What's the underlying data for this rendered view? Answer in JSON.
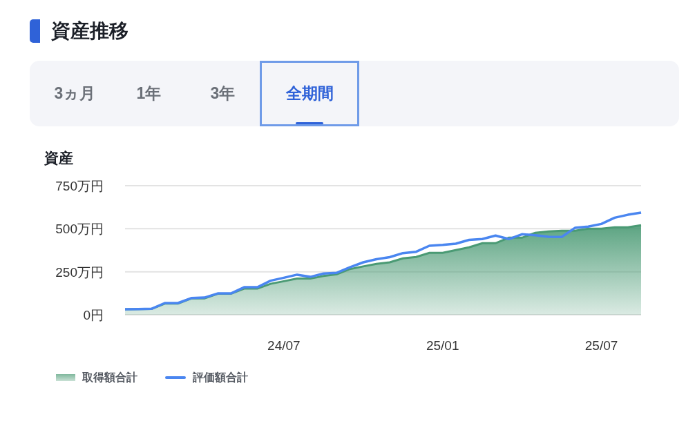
{
  "title": "資産推移",
  "tabs": [
    {
      "label": "3ヵ月",
      "selected": false
    },
    {
      "label": "1年",
      "selected": false
    },
    {
      "label": "3年",
      "selected": false
    },
    {
      "label": "全期間",
      "selected": true
    }
  ],
  "chart": {
    "chart_data": {
      "type": "area",
      "ylabel": "資産",
      "categories": [
        null,
        null,
        null,
        null,
        null,
        null,
        null,
        null,
        null,
        null,
        null,
        null,
        "24/07",
        null,
        null,
        null,
        null,
        null,
        null,
        null,
        null,
        null,
        null,
        null,
        "25/01",
        null,
        null,
        null,
        null,
        null,
        null,
        null,
        null,
        null,
        null,
        null,
        "25/07",
        null,
        null,
        null
      ],
      "series": [
        {
          "name": "取得額合計",
          "type": "area",
          "color": "#4a9a74",
          "values": [
            32,
            33,
            34,
            65,
            65,
            95,
            95,
            122,
            122,
            152,
            152,
            180,
            195,
            210,
            210,
            226,
            236,
            266,
            281,
            296,
            305,
            328,
            336,
            360,
            360,
            376,
            392,
            416,
            416,
            448,
            448,
            476,
            484,
            488,
            488,
            500,
            500,
            508,
            508,
            520
          ]
        },
        {
          "name": "評価額合計",
          "type": "line",
          "color": "#4a86f0",
          "values": [
            32,
            33,
            35,
            68,
            68,
            97,
            100,
            124,
            124,
            160,
            160,
            198,
            215,
            233,
            220,
            240,
            244,
            276,
            305,
            323,
            335,
            358,
            366,
            401,
            406,
            413,
            435,
            440,
            460,
            440,
            468,
            462,
            453,
            452,
            505,
            512,
            528,
            564,
            581,
            594
          ]
        }
      ],
      "ylim": [
        0,
        750
      ],
      "yticks": [
        {
          "value": 0,
          "label": "0円"
        },
        {
          "value": 250,
          "label": "250万円"
        },
        {
          "value": 500,
          "label": "500万円"
        },
        {
          "value": 750,
          "label": "750万円"
        }
      ]
    }
  }
}
